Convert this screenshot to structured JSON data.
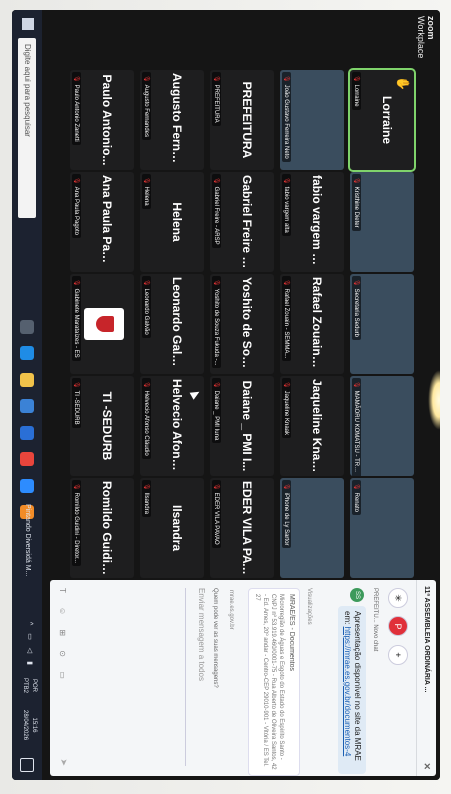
{
  "app": {
    "brand": "zoom",
    "product": "Workplace"
  },
  "tiles": [
    {
      "name": "Lorraine",
      "label": "Lorraine",
      "active": true,
      "hand": true
    },
    {
      "name": "",
      "label": "Kristhine Dieter",
      "video": true
    },
    {
      "name": "",
      "label": "Secretaria Sedurb",
      "video": true
    },
    {
      "name": "",
      "label": "MAMÃORU KOMATSU - TRANS...",
      "video": true
    },
    {
      "name": "",
      "label": "Renato",
      "video": true
    },
    {
      "name": "",
      "label": "João Gustavo Ferreira Neto",
      "video": true
    },
    {
      "name": "fabio vargem alta",
      "label": "fabio vargem alta"
    },
    {
      "name": "Rafael Zouain -...",
      "label": "Rafael Zouain - SEMMA..."
    },
    {
      "name": "Jaqueline Knaak",
      "label": "Jaqueline Knaak"
    },
    {
      "name": "",
      "label": "iPhone de Ly Sartor",
      "video": true
    },
    {
      "name": "PREFEITURA",
      "label": "PREFEITURA"
    },
    {
      "name": "Gabriel Freire -...",
      "label": "Gabriel Freire - ARSP"
    },
    {
      "name": "Yoshito de Souz...",
      "label": "Yoshito de Souza Fukuda -..."
    },
    {
      "name": "Daiane _ PMI I...",
      "label": "Daiane _ PMI Iuna"
    },
    {
      "name": "EDER VILA PAV...",
      "label": "EDER VILA PAVAO"
    },
    {
      "name": "Augusto Fernan...",
      "label": "Augusto Fernandes"
    },
    {
      "name": "Helena",
      "label": "Helena"
    },
    {
      "name": "Leonardo Galvão",
      "label": "Leonardo Galvão"
    },
    {
      "name": "Helvecio Afons...",
      "label": "Helvecio Afonso Cláudio"
    },
    {
      "name": "Ilsandra",
      "label": "Ilsandra"
    },
    {
      "name": "Paulo Antonio...",
      "label": "Paulo Antonio Zanetti"
    },
    {
      "name": "Ana Paula Pagoto",
      "label": "Ana Paula Pagoto"
    },
    {
      "name": "",
      "label": "Gabinete Marataízes - ES",
      "logo": true
    },
    {
      "name": "TI -SEDURB",
      "label": "TI -SEDURB"
    },
    {
      "name": "Romildo Guidin...",
      "label": "Romildo Guidini - Diretor..."
    }
  ],
  "chat": {
    "title": "11ª ASSEMBLEIA ORDINÁRIA ...",
    "reactions": [
      "✳",
      "P",
      "+"
    ],
    "sender_line": "PREFEITU... Novo chat",
    "bubble_text": "Apresentação disponível no site da MRAE em:",
    "bubble_link": "https://mrae.es.gov.br/documentos-4",
    "visible_to": "Visualizações",
    "card_title": "MRAE/ES - Documentos",
    "card_text": "Microrregião de Águas e Esgoto do Estado do Espírito Santo - CNPJ nº 53.919.460/0001-75 - Rua Alberto de Oliveira Santos, 42 - Ed. Ames, 20º andar - Centro-CEP 29010-901 - Vitória / ES Tel. 27",
    "sent_line": "mrae.es.gov.br",
    "who_line": "Quem pode ver as suas mensagens?",
    "input_placeholder": "Enviar mensagem a todos"
  },
  "taskbar": {
    "search_placeholder": "Digite aqui para pesquisar",
    "task_label": "Pintando Diversidá M...",
    "lang_top": "POR",
    "lang_bottom": "PTB2",
    "time": "15:16",
    "date": "28/04/2026"
  },
  "colors": {
    "active_border": "#7fd36b",
    "mic_muted": "#e33333",
    "taskbar": "#1c2230"
  }
}
